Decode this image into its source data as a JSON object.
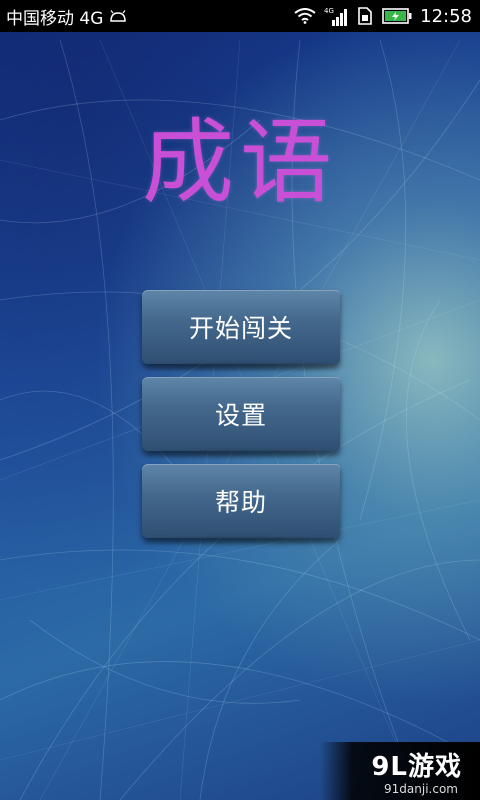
{
  "statusbar": {
    "carrier": "中国移动 4G",
    "time": "12:58",
    "network_type": "4G"
  },
  "icons": {
    "android": "android-icon",
    "wifi": "wifi-icon",
    "signal": "signal-icon",
    "sim": "sim-icon",
    "battery": "battery-icon"
  },
  "app": {
    "title": "成语"
  },
  "menu": {
    "items": [
      {
        "label": "开始闯关"
      },
      {
        "label": "设置"
      },
      {
        "label": "帮助"
      }
    ]
  },
  "watermark": {
    "logo": "9L游戏",
    "url": "91danji.com"
  },
  "colors": {
    "title": "#c94fd6",
    "statusbar_bg": "#000000",
    "button_top": "#5f86a8",
    "button_bottom": "#2f4f72"
  }
}
